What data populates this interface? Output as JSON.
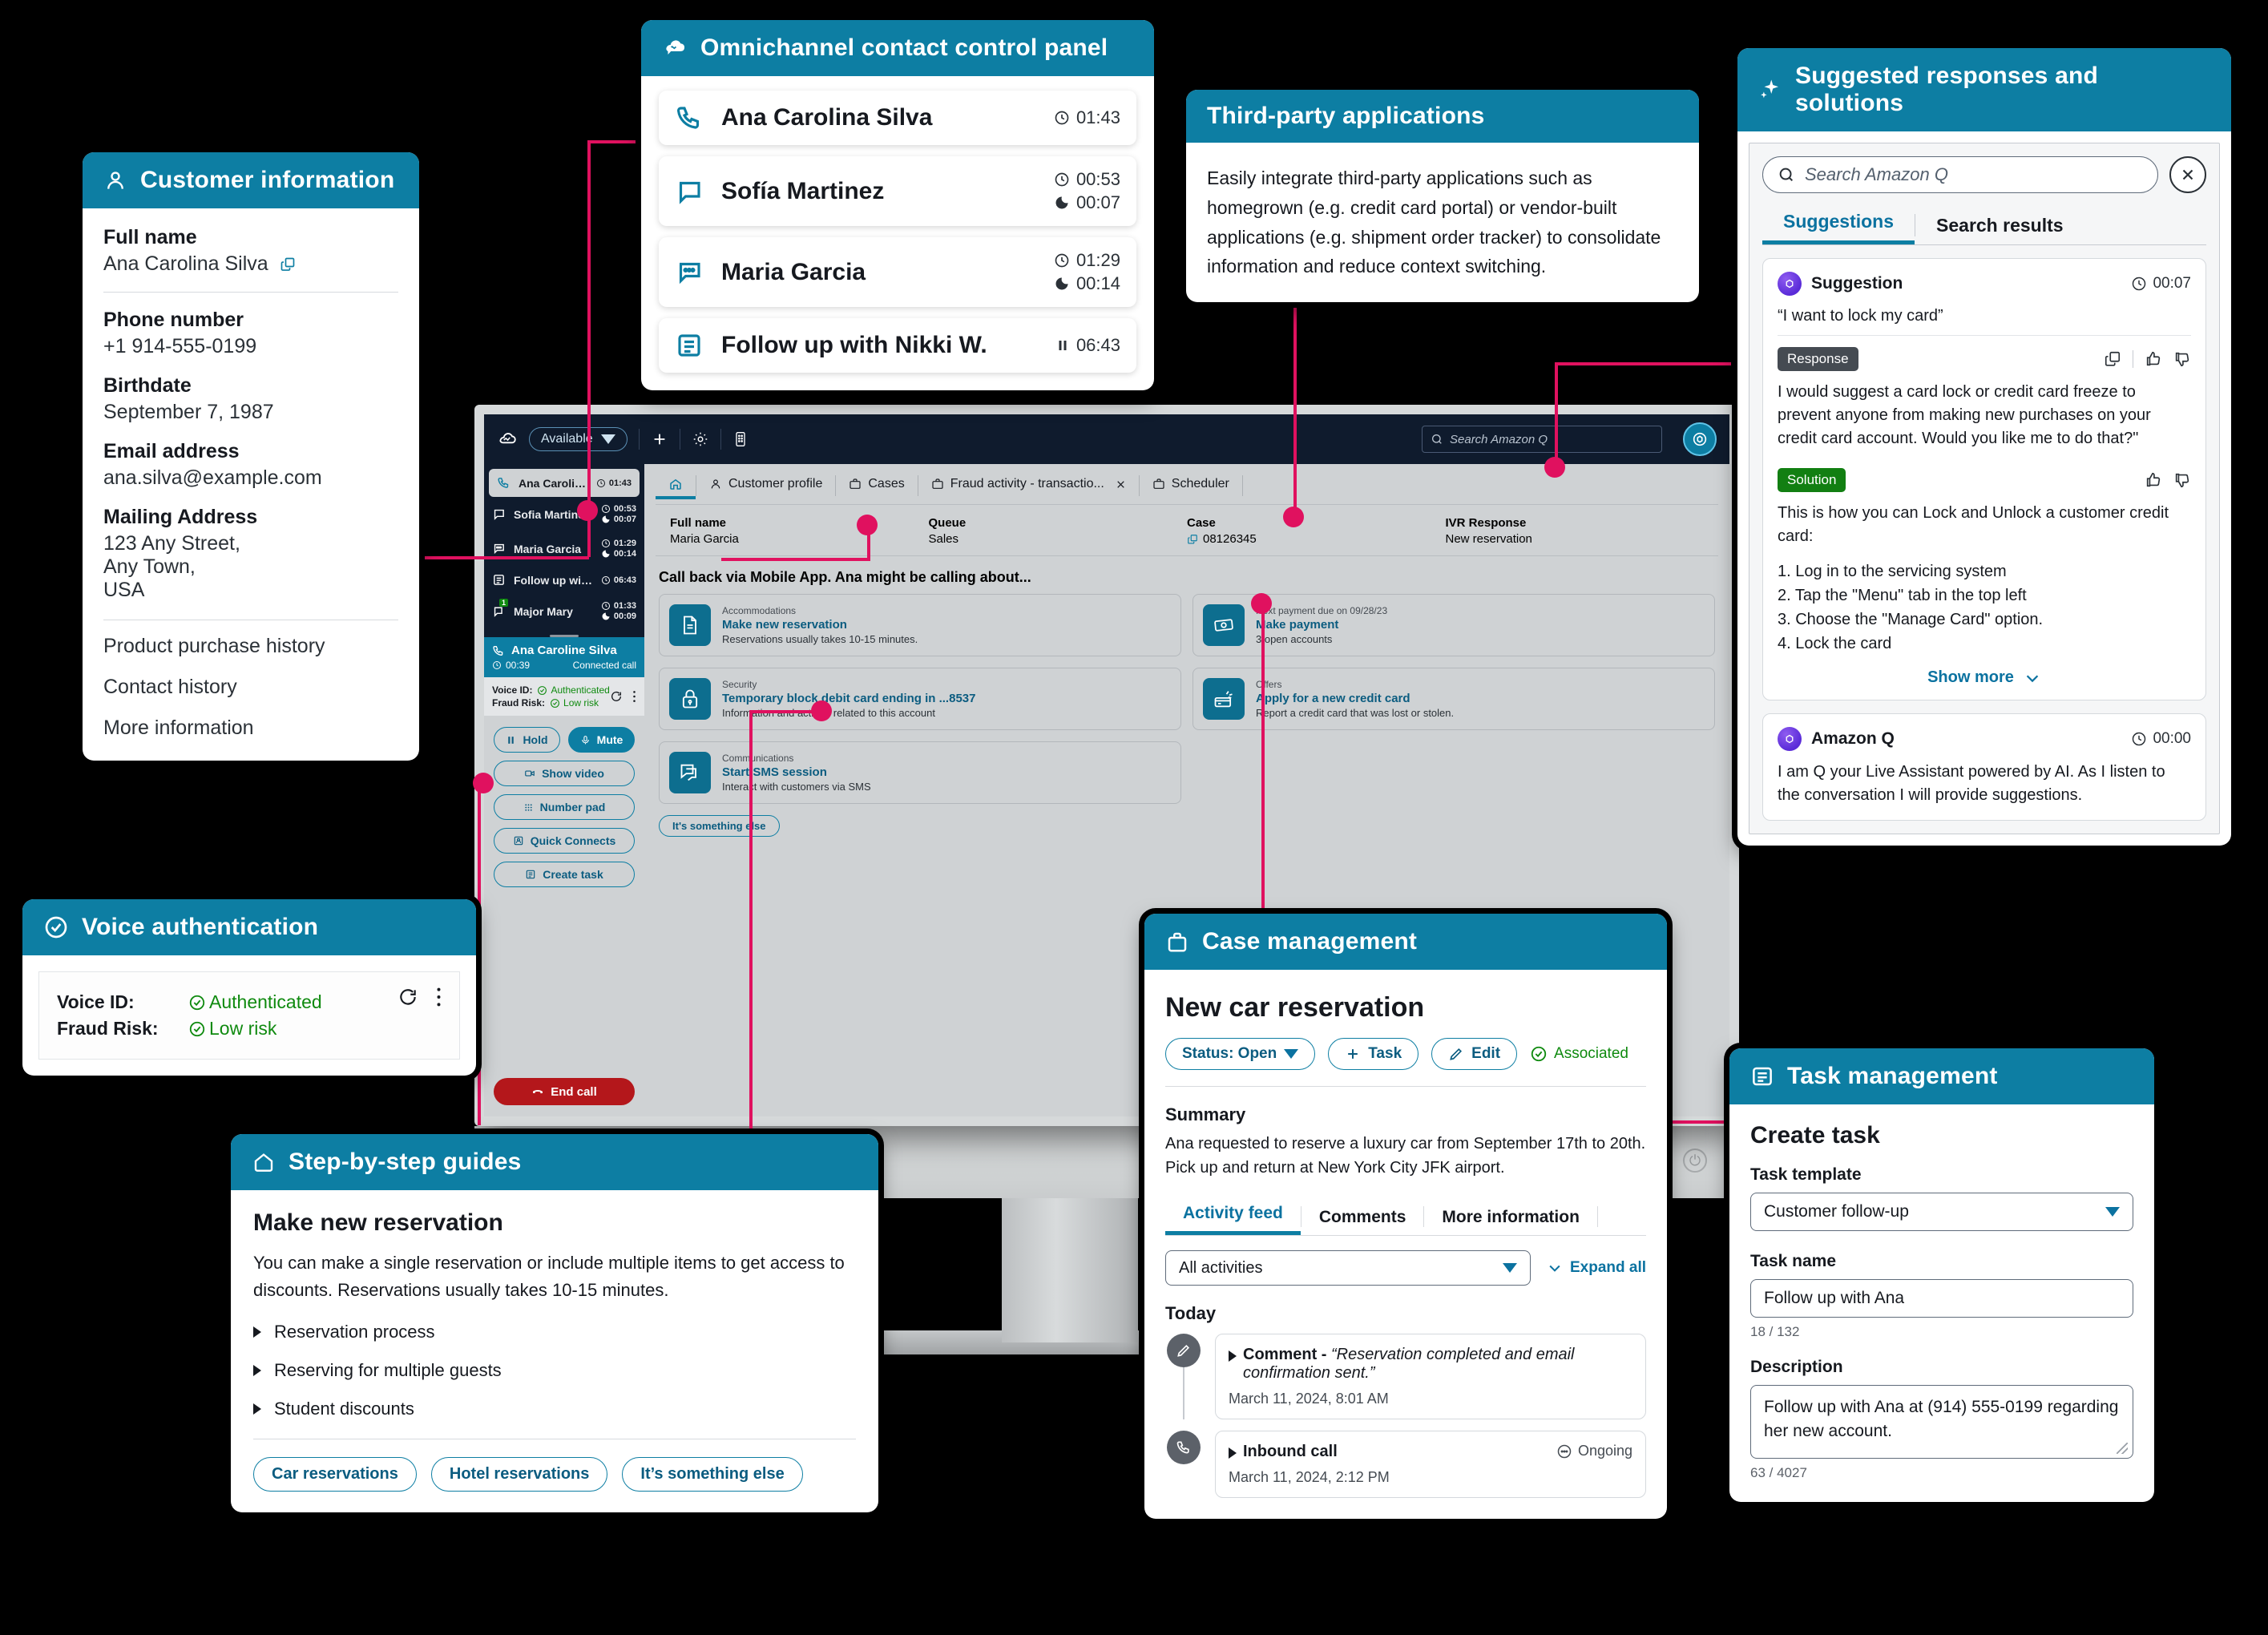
{
  "customer_information": {
    "title": "Customer information",
    "icon": "user-icon",
    "fields": [
      {
        "label": "Full name",
        "value": "Ana Carolina Silva",
        "copy": true
      },
      {
        "label": "Phone number",
        "value": "+1 914-555-0199"
      },
      {
        "label": "Birthdate",
        "value": "September 7, 1987"
      },
      {
        "label": "Email address",
        "value": "ana.silva@example.com"
      },
      {
        "label": "Mailing Address",
        "value": "123 Any Street,\nAny Town,\nUSA"
      }
    ],
    "links": [
      "Product purchase history",
      "Contact history",
      "More information"
    ]
  },
  "omnichannel_panel": {
    "title": "Omnichannel contact control panel",
    "icon": "connect-cloud-icon",
    "contacts": [
      {
        "name": "Ana Carolina Silva",
        "icon": "phone-icon",
        "times": [
          "01:43"
        ]
      },
      {
        "name": "Sofía Martinez",
        "icon": "chat-icon",
        "times": [
          "00:53",
          "00:07"
        ]
      },
      {
        "name": "Maria Garcia",
        "icon": "sms-icon",
        "times": [
          "01:29",
          "00:14"
        ]
      },
      {
        "name": "Follow up with Nikki W.",
        "icon": "task-icon",
        "times": [
          "06:43"
        ],
        "paused": true
      }
    ]
  },
  "third_party": {
    "title": "Third-party applications",
    "body": "Easily integrate third-party applications such as homegrown (e.g. credit card portal) or vendor-built applications (e.g. shipment order tracker) to consolidate information and reduce context switching."
  },
  "suggestions_panel": {
    "title": "Suggested responses and solutions",
    "icon": "sparkle-icon",
    "search_placeholder": "Search Amazon Q",
    "tabs": [
      {
        "label": "Suggestions",
        "selected": true
      },
      {
        "label": "Search results",
        "selected": false
      }
    ],
    "cards": [
      {
        "author": "Suggestion",
        "time": "00:07",
        "quote": "“I want to lock my card”",
        "response_badge": "Response",
        "response_text": "I would suggest a card lock or credit card freeze to prevent anyone from making new purchases on your credit card account. Would you like me to do that?\"",
        "solution_badge": "Solution",
        "solution_intro": "This is how you can Lock and Unlock a customer credit card:",
        "solution_steps": [
          "1. Log in to the servicing system",
          "2. Tap the \"Menu\" tab in the top left",
          "3. Choose the \"Manage Card\" option.",
          "4. Lock the card"
        ],
        "show_more": "Show more"
      },
      {
        "author": "Amazon Q",
        "time": "00:00",
        "text": "I am Q your Live Assistant powered by AI. As I listen to the conversation I will provide suggestions."
      }
    ]
  },
  "case_management": {
    "title": "Case management",
    "icon": "briefcase-icon",
    "case_title": "New car reservation",
    "buttons": [
      {
        "label": "Status: Open",
        "icon": "chevron-down-icon"
      },
      {
        "label": "Task",
        "icon": "plus-icon"
      },
      {
        "label": "Edit",
        "icon": "pencil-icon"
      }
    ],
    "associated_label": "Associated",
    "summary_label": "Summary",
    "summary_text": "Ana requested to reserve a luxury car from September 17th to 20th. Pick up and return at New York City JFK airport.",
    "tabs": [
      {
        "label": "Activity feed",
        "selected": true
      },
      {
        "label": "Comments",
        "selected": false
      },
      {
        "label": "More information",
        "selected": false
      }
    ],
    "filter_value": "All activities",
    "expand_label": "Expand all",
    "day_label": "Today",
    "activities": [
      {
        "icon": "pencil-icon",
        "title": "Comment -",
        "quote": "“Reservation completed and email confirmation sent.”",
        "date": "March 11, 2024, 8:01 AM"
      },
      {
        "icon": "phone-icon",
        "title": "Inbound call",
        "status": "Ongoing",
        "date": "March 11, 2024, 2:12 PM"
      }
    ]
  },
  "task_management": {
    "title": "Task management",
    "icon": "task-icon",
    "heading": "Create task",
    "template_label": "Task template",
    "template_value": "Customer follow-up",
    "name_label": "Task name",
    "name_value": "Follow up with Ana",
    "name_counter": "18 / 132",
    "description_label": "Description",
    "description_value": "Follow up with Ana at (914) 555-0199 regarding her new account.",
    "description_counter": "63 / 4027"
  },
  "guides": {
    "title": "Step-by-step guides",
    "icon": "home-icon",
    "heading": "Make new reservation",
    "body": "You can make a single reservation or include multiple items to get access to discounts. Reservations usually takes 10-15 minutes.",
    "items": [
      "Reservation process",
      "Reserving for multiple guests",
      "Student discounts"
    ],
    "buttons": [
      "Car reservations",
      "Hotel reservations",
      "It’s something else"
    ]
  },
  "voice_authentication": {
    "title": "Voice authentication",
    "icon": "check-circle-icon",
    "rows": [
      {
        "label": "Voice ID:",
        "value": "Authenticated"
      },
      {
        "label": "Fraud Risk:",
        "value": "Low risk"
      }
    ],
    "actions": [
      "refresh-icon",
      "more-vertical-icon"
    ]
  },
  "workspace": {
    "top_bar": {
      "availability": "Available",
      "search_placeholder": "Search Amazon Q",
      "icons": [
        "plus-icon",
        "gear-icon",
        "phone-keypad-icon",
        "amazon-q-icon"
      ]
    },
    "ccp": {
      "contacts": [
        {
          "name": "Ana Caroline Silva",
          "icon": "phone-icon",
          "times": [
            "01:43"
          ],
          "active": true
        },
        {
          "name": "Sofia Martinez",
          "icon": "chat-icon",
          "times": [
            "00:53",
            "00:07"
          ]
        },
        {
          "name": "Maria Garcia",
          "icon": "sms-icon",
          "times": [
            "01:29",
            "00:14"
          ]
        },
        {
          "name": "Follow up with Nikki W.",
          "icon": "task-icon",
          "times": [
            "06:43"
          ]
        },
        {
          "name": "Major Mary",
          "icon": "chat-badge-icon",
          "badge": "1",
          "times": [
            "01:33",
            "00:09"
          ]
        }
      ],
      "active_contact": {
        "name": "Ana Caroline Silva",
        "time": "00:39",
        "status": "Connected call"
      },
      "auth": [
        {
          "label": "Voice ID:",
          "value": "Authenticated"
        },
        {
          "label": "Fraud Risk:",
          "value": "Low risk"
        }
      ],
      "controls": [
        {
          "label": "Hold",
          "icon": "pause-icon",
          "filled": false
        },
        {
          "label": "Mute",
          "icon": "mic-icon",
          "filled": true
        },
        {
          "label": "Show video",
          "icon": "video-icon",
          "filled": false
        },
        {
          "label": "Number pad",
          "icon": "keypad-icon",
          "filled": false
        },
        {
          "label": "Quick Connects",
          "icon": "contact-icon",
          "filled": false
        },
        {
          "label": "Create task",
          "icon": "task-icon",
          "filled": false
        }
      ],
      "end_call": "End call"
    },
    "tabs": [
      {
        "label": "",
        "icon": "home-icon",
        "selected": true
      },
      {
        "label": "Customer profile",
        "icon": "user-icon"
      },
      {
        "label": "Cases",
        "icon": "briefcase-icon"
      },
      {
        "label": "Fraud activity - transactio...",
        "icon": "briefcase-icon",
        "closable": true
      },
      {
        "label": "Scheduler",
        "icon": "briefcase-icon"
      }
    ],
    "meta": [
      {
        "label": "Full name",
        "value": "Maria Garcia"
      },
      {
        "label": "Queue",
        "value": "Sales"
      },
      {
        "label": "Case",
        "value": "08126345",
        "copy": true
      },
      {
        "label": "IVR Response",
        "value": "New reservation"
      }
    ],
    "heading": "Call back via Mobile App. Ana might be calling about...",
    "tiles": [
      {
        "kicker": "Accommodations",
        "title": "Make new reservation",
        "sub": "Reservations usually takes 10-15 minutes.",
        "icon": "document-icon"
      },
      {
        "kicker": "Next payment due on 09/28/23",
        "title": "Make payment",
        "sub": "3 open accounts",
        "icon": "money-icon"
      },
      {
        "kicker": "Security",
        "title": "Temporary block debit card ending in ...8537",
        "sub": "Information and actions related to this account",
        "icon": "lock-icon"
      },
      {
        "kicker": "Offers",
        "title": "Apply for a new credit card",
        "sub": "Report a credit card that was lost or stolen.",
        "icon": "card-icon"
      },
      {
        "kicker": "Communications",
        "title": "Start SMS session",
        "sub": "Interact with customers via SMS",
        "icon": "chat-icon"
      }
    ],
    "else_button": "It's something else"
  },
  "colors": {
    "header_teal": "#0d7ea3",
    "accent_pink": "#e0115f",
    "success_green": "#0f8a0f",
    "solution_green": "#127f12",
    "danger_red": "#b4171b",
    "dark_navy": "#0f1b2d"
  }
}
